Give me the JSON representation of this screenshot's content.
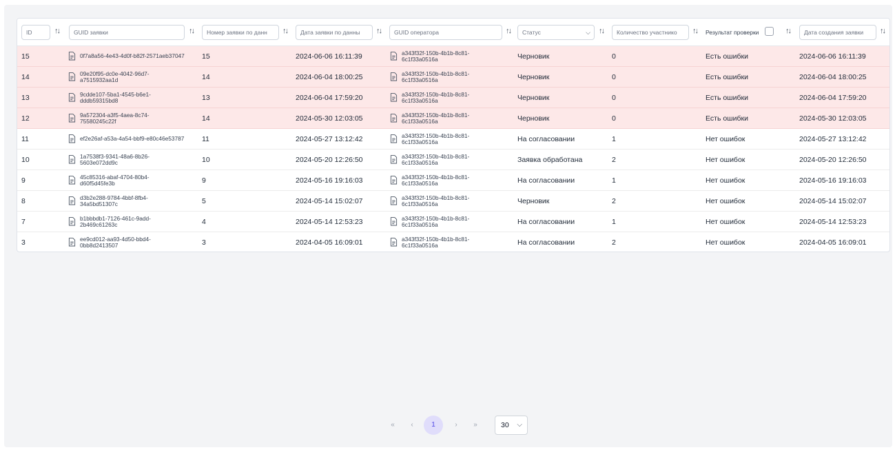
{
  "headers": {
    "id": "ID",
    "guid": "GUID заявки",
    "number": "Номер заявки по данн",
    "date": "Дата заявки по данны",
    "operator": "GUID оператора",
    "status": "Статус",
    "participants": "Количество участнико",
    "check": "Результат проверки",
    "created": "Дата создания заявки"
  },
  "icons": {
    "sort": "sort-arrows-icon",
    "doc": "document-icon",
    "chevron": "chevron-down-icon"
  },
  "colors": {
    "error_row": "#fde8e8",
    "accent": "#4f46e5",
    "current_page_bg": "#e0ddfb"
  },
  "rows": [
    {
      "id": "15",
      "guid": "0f7a8a56-4e43-4d0f-b82f-2571aeb37047",
      "guid1": "0f7a8a56-4e43-4d0f-b82f-2571aeb37047",
      "guid2": "",
      "number": "15",
      "date": "2024-06-06 16:11:39",
      "op1": "a343f32f-150b-4b1b-8c81-",
      "op2": "6c1f33a0516a",
      "status": "Черновик",
      "participants": "0",
      "check": "Есть ошибки",
      "created": "2024-06-06 16:11:39",
      "error": true
    },
    {
      "id": "14",
      "guid1": "09e20f95-dc0e-4042-96d7-",
      "guid2": "a7515932aa1d",
      "number": "14",
      "date": "2024-06-04 18:00:25",
      "op1": "a343f32f-150b-4b1b-8c81-",
      "op2": "6c1f33a0516a",
      "status": "Черновик",
      "participants": "0",
      "check": "Есть ошибки",
      "created": "2024-06-04 18:00:25",
      "error": true
    },
    {
      "id": "13",
      "guid1": "9cdde107-5ba1-4545-b6e1-",
      "guid2": "dddb59315bd8",
      "number": "13",
      "date": "2024-06-04 17:59:20",
      "op1": "a343f32f-150b-4b1b-8c81-",
      "op2": "6c1f33a0516a",
      "status": "Черновик",
      "participants": "0",
      "check": "Есть ошибки",
      "created": "2024-06-04 17:59:20",
      "error": true
    },
    {
      "id": "12",
      "guid1": "9a572304-a3f5-4aea-8c74-",
      "guid2": "75580245c22f",
      "number": "14",
      "date": "2024-05-30 12:03:05",
      "op1": "a343f32f-150b-4b1b-8c81-",
      "op2": "6c1f33a0516a",
      "status": "Черновик",
      "participants": "0",
      "check": "Есть ошибки",
      "created": "2024-05-30 12:03:05",
      "error": true
    },
    {
      "id": "11",
      "guid1": "ef2e26af-a53a-4a54-bbf9-e80c46e53787",
      "guid2": "",
      "number": "11",
      "date": "2024-05-27 13:12:42",
      "op1": "a343f32f-150b-4b1b-8c81-",
      "op2": "6c1f33a0516a",
      "status": "На согласовании",
      "participants": "1",
      "check": "Нет ошибок",
      "created": "2024-05-27 13:12:42",
      "error": false
    },
    {
      "id": "10",
      "guid1": "1a7538f3-9341-48a6-8b26-",
      "guid2": "5603e072dd9c",
      "number": "10",
      "date": "2024-05-20 12:26:50",
      "op1": "a343f32f-150b-4b1b-8c81-",
      "op2": "6c1f33a0516a",
      "status": "Заявка обработана",
      "participants": "2",
      "check": "Нет ошибок",
      "created": "2024-05-20 12:26:50",
      "error": false
    },
    {
      "id": "9",
      "guid1": "45c85316-abaf-4704-80b4-",
      "guid2": "d60f5d45fe3b",
      "number": "9",
      "date": "2024-05-16 19:16:03",
      "op1": "a343f32f-150b-4b1b-8c81-",
      "op2": "6c1f33a0516a",
      "status": "На согласовании",
      "participants": "1",
      "check": "Нет ошибок",
      "created": "2024-05-16 19:16:03",
      "error": false
    },
    {
      "id": "8",
      "guid1": "d3b2e288-9784-4bbf-8fb4-",
      "guid2": "34a5bd51307c",
      "number": "5",
      "date": "2024-05-14 15:02:07",
      "op1": "a343f32f-150b-4b1b-8c81-",
      "op2": "6c1f33a0516a",
      "status": "Черновик",
      "participants": "2",
      "check": "Нет ошибок",
      "created": "2024-05-14 15:02:07",
      "error": false
    },
    {
      "id": "7",
      "guid1": "b1bbbdb1-7126-461c-9add-",
      "guid2": "2b469c61263c",
      "number": "4",
      "date": "2024-05-14 12:53:23",
      "op1": "a343f32f-150b-4b1b-8c81-",
      "op2": "6c1f33a0516a",
      "status": "На согласовании",
      "participants": "1",
      "check": "Нет ошибок",
      "created": "2024-05-14 12:53:23",
      "error": false
    },
    {
      "id": "3",
      "guid1": "ee9cd012-aa93-4d50-bbd4-",
      "guid2": "0bb8d2413507",
      "number": "3",
      "date": "2024-04-05 16:09:01",
      "op1": "a343f32f-150b-4b1b-8c81-",
      "op2": "6c1f33a0516a",
      "status": "На согласовании",
      "participants": "2",
      "check": "Нет ошибок",
      "created": "2024-04-05 16:09:01",
      "error": false
    }
  ],
  "pagination": {
    "first": "«",
    "prev": "‹",
    "current": "1",
    "next": "›",
    "last": "»",
    "page_size": "30"
  }
}
